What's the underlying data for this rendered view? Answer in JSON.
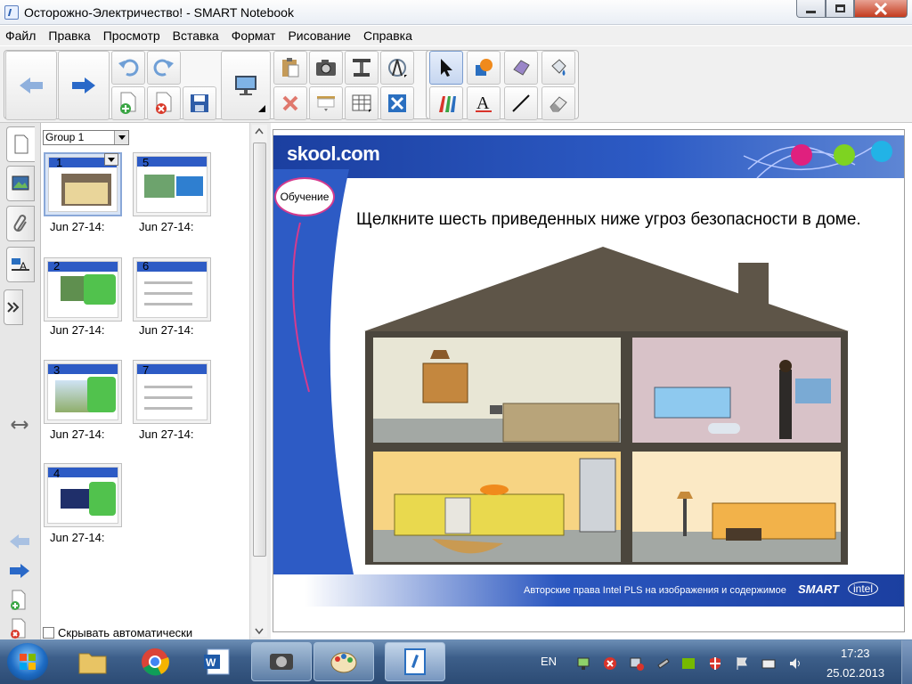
{
  "window": {
    "title": "Осторожно-Электричество! - SMART Notebook"
  },
  "menu": [
    "Файл",
    "Правка",
    "Просмотр",
    "Вставка",
    "Формат",
    "Рисование",
    "Справка"
  ],
  "toolbar": {
    "icons": [
      "back-arrow-icon",
      "forward-arrow-icon",
      "undo-icon",
      "redo-icon",
      "add-page-icon",
      "delete-page-icon",
      "save-icon",
      "display-icon",
      "paste-icon",
      "screenshot-icon",
      "document-camera-icon",
      "compass-icon",
      "delete-icon",
      "screen-shade-icon",
      "table-icon",
      "fullscreen-icon",
      "select-icon",
      "shapes-icon",
      "eraser-polygon-icon",
      "fill-icon",
      "pens-icon",
      "text-icon",
      "line-icon",
      "eraser-icon"
    ]
  },
  "sorter": {
    "group_label": "Group 1",
    "thumbnails": [
      {
        "num": "1",
        "date": "Jun  27-14:"
      },
      {
        "num": "5",
        "date": "Jun  27-14:"
      },
      {
        "num": "2",
        "date": "Jun  27-14:"
      },
      {
        "num": "6",
        "date": "Jun  27-14:"
      },
      {
        "num": "3",
        "date": "Jun  27-14:"
      },
      {
        "num": "7",
        "date": "Jun  27-14:"
      },
      {
        "num": "4",
        "date": "Jun  27-14:"
      }
    ],
    "autohide_label": "Скрывать автоматически"
  },
  "slide": {
    "logo": "skool.com",
    "badge": "Обучение",
    "instruction": "Щелкните шесть приведенных ниже угроз безопасности в доме.",
    "footer": "Авторские права Intel PLS на изображения и содержимое",
    "smart": "SMART",
    "intel": "intel"
  },
  "taskbar": {
    "lang": "EN",
    "time": "17:23",
    "date": "25.02.2013"
  }
}
